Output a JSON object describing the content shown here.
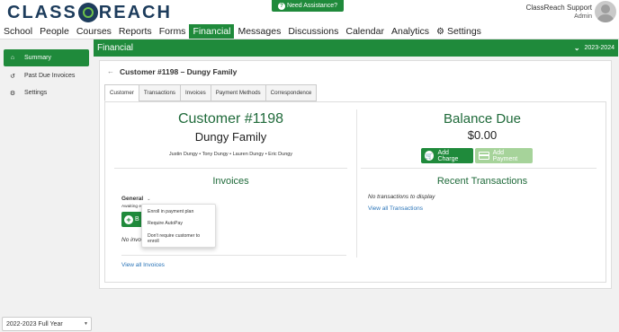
{
  "app": {
    "logo_text_left": "CLASS",
    "logo_text_right": "REACH",
    "assistance_label": "Need Assistance?",
    "user_name": "ClassReach Support",
    "user_role": "Admin"
  },
  "nav": {
    "items": [
      {
        "label": "School"
      },
      {
        "label": "People"
      },
      {
        "label": "Courses"
      },
      {
        "label": "Reports"
      },
      {
        "label": "Forms"
      },
      {
        "label": "Financial"
      },
      {
        "label": "Messages"
      },
      {
        "label": "Discussions"
      },
      {
        "label": "Calendar"
      },
      {
        "label": "Analytics"
      },
      {
        "label": "Settings"
      }
    ],
    "active": "Financial"
  },
  "sidebar": {
    "items": [
      {
        "label": "Summary",
        "icon": "home-icon"
      },
      {
        "label": "Past Due Invoices",
        "icon": "history-icon"
      },
      {
        "label": "Settings",
        "icon": "gear-icon"
      }
    ],
    "year_select": "2022-2023 Full Year"
  },
  "header": {
    "title": "Financial",
    "year": "2023-2024"
  },
  "customer": {
    "title": "Customer #1198 – Dungy Family",
    "number_label": "Customer #1198",
    "family_name": "Dungy Family",
    "members": "Justin Dungy • Tony Dungy • Lauren Dungy • Eric Dungy"
  },
  "tabs": [
    "Customer",
    "Transactions",
    "Invoices",
    "Payment Methods",
    "Correspondence"
  ],
  "balance": {
    "label": "Balance Due",
    "value": "$0.00",
    "add_charge": "Add Charge",
    "add_payment": "Add Payment"
  },
  "invoices": {
    "title": "Invoices",
    "group": "General",
    "awaiting": "Awaiting e",
    "button_partial": "B",
    "no_invoice_partial": "No invoi",
    "view_all": "View all Invoices"
  },
  "recent": {
    "title": "Recent Transactions",
    "empty": "No transactions to display",
    "view_all": "View all Transactions"
  },
  "dropdown": {
    "items": [
      {
        "label": "Enroll in payment plan"
      },
      {
        "label": "Require AutoPay"
      },
      {
        "label": "Don't require customer to enroll"
      }
    ]
  },
  "colors": {
    "brand_green": "#1f8a3b",
    "heading_green": "#1f6a3a",
    "link_blue": "#2a74b8",
    "navy": "#1d3c5c"
  }
}
